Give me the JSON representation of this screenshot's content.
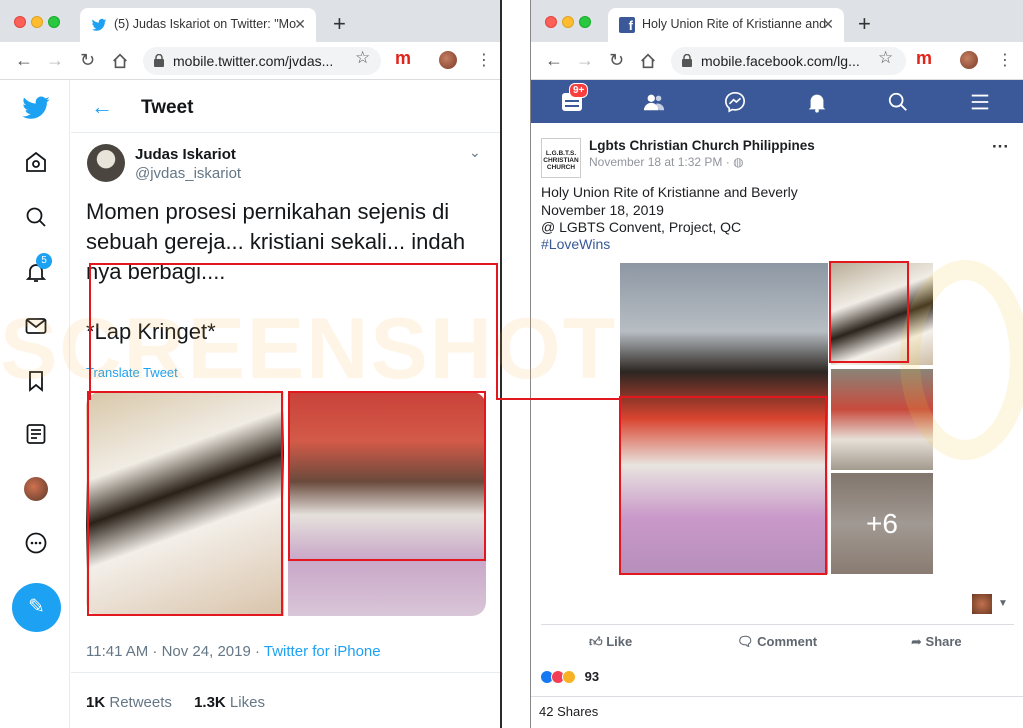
{
  "left_browser": {
    "tab_title": "(5) Judas Iskariot on Twitter: \"Mo",
    "url": "mobile.twitter.com/jvdas..."
  },
  "right_browser": {
    "tab_title": "Holy Union Rite of Kristianne and",
    "url": "mobile.facebook.com/lg..."
  },
  "twitter": {
    "header_title": "Tweet",
    "notification_count": "5",
    "author_name": "Judas Iskariot",
    "author_handle": "@jvdas_iskariot",
    "tweet_text": "Momen prosesi pernikahan sejenis di sebuah gereja... kristiani sekali... indah nya berbagi....\n\n*Lap Kringet*",
    "translate_label": "Translate Tweet",
    "timestamp": "11:41 AM · Nov 24, 2019 · ",
    "source": "Twitter for iPhone",
    "retweets_count": "1K",
    "retweets_label": "Retweets",
    "likes_count": "1.3K",
    "likes_label": "Likes"
  },
  "facebook": {
    "notification_badge": "9+",
    "page_name": "Lgbts Christian Church Philippines",
    "page_logo_text": "L.G.B.T.S. CHRISTIAN CHURCH",
    "post_time": "November 18 at 1:32 PM · ",
    "post_text": "Holy Union Rite of Kristianne and Beverly\nNovember 18, 2019\n@ LGBTS Convent, Project, QC",
    "hashtag": "#LoveWins",
    "more_photos": "+6",
    "like_label": "Like",
    "comment_label": "Comment",
    "share_label": "Share",
    "reaction_count": "93",
    "shares": "42 Shares"
  },
  "watermark": "SCREENSHOT",
  "colors": {
    "twitter_blue": "#1da1f2",
    "facebook_blue": "#3b5998",
    "annotation_red": "#e3181e"
  }
}
